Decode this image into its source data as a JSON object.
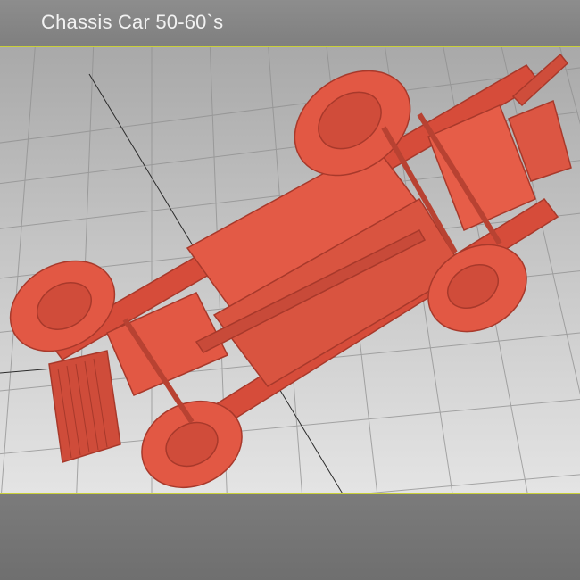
{
  "header": {
    "title": "Chassis Car 50-60`s"
  },
  "viewport": {
    "model_color": "#e0523f",
    "grid_color": "#8f8f8f",
    "axis_color": "#2a2a2a",
    "accent_line_color": "#c9cf3a"
  }
}
